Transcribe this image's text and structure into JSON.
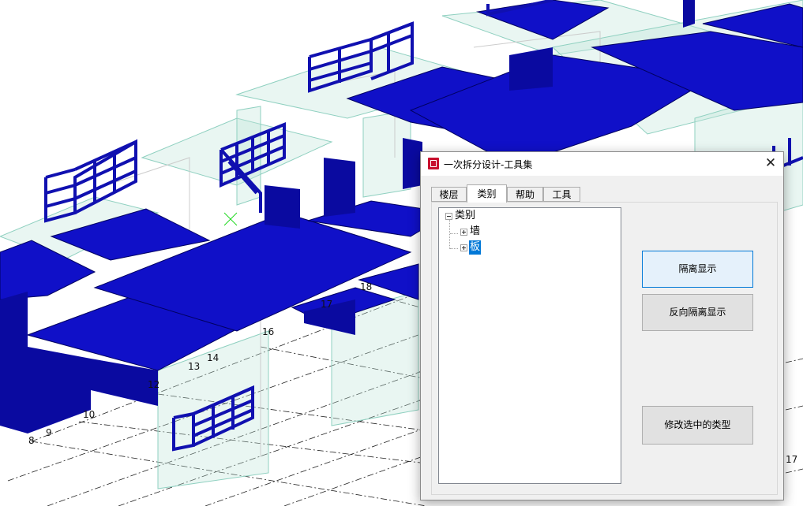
{
  "dialog": {
    "title": "一次拆分设计-工具集",
    "close_symbol": "✕",
    "icon": "app-logo-icon",
    "tabs": [
      {
        "label": "楼层",
        "active": false
      },
      {
        "label": "类别",
        "active": true
      },
      {
        "label": "帮助",
        "active": false
      },
      {
        "label": "工具",
        "active": false
      }
    ],
    "tree": {
      "root": {
        "label": "类别",
        "expanded": true
      },
      "children": [
        {
          "label": "墙",
          "expanded": false,
          "selected": false
        },
        {
          "label": "板",
          "expanded": false,
          "selected": true
        }
      ]
    },
    "buttons": {
      "isolate": "隔离显示",
      "reverse_isolate": "反向隔离显示",
      "modify_type": "修改选中的类型"
    }
  },
  "viewport": {
    "grid_labels": [
      "8",
      "9",
      "10",
      "12",
      "13",
      "14",
      "16",
      "17",
      "18",
      "17"
    ],
    "colors": {
      "slab": "#1010c8",
      "rail": "#1010b0",
      "background": "#ffffff"
    }
  }
}
